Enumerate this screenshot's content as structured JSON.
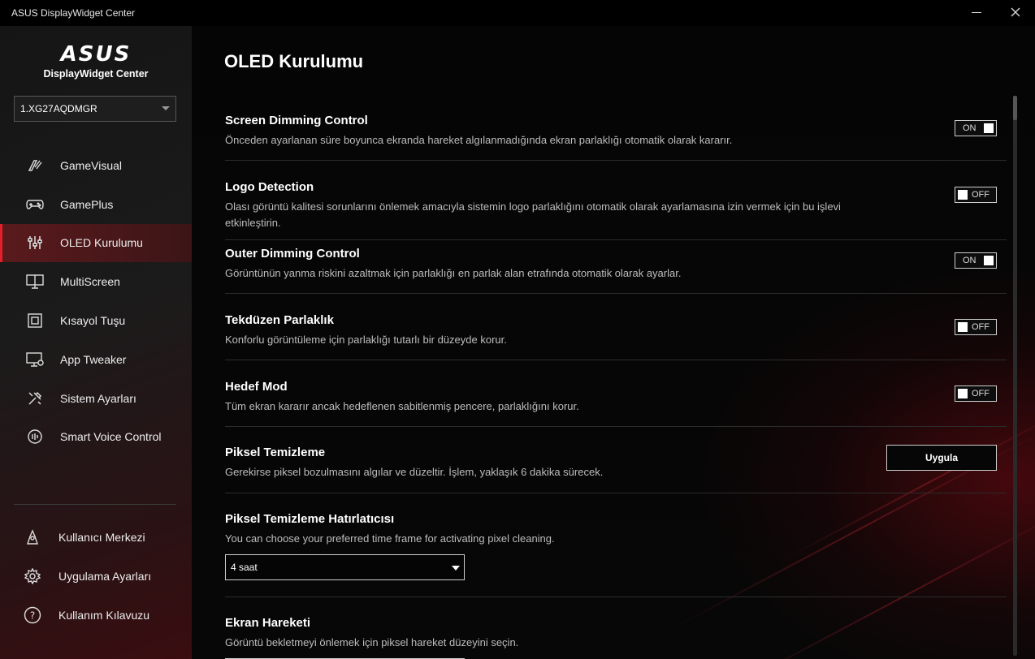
{
  "window": {
    "title": "ASUS DisplayWidget Center"
  },
  "brand": {
    "logo": "ASUS",
    "subtitle": "DisplayWidget Center"
  },
  "monitor": {
    "selected": "1.XG27AQDMGR"
  },
  "nav": [
    {
      "label": "GameVisual",
      "icon": "gamevisual-icon"
    },
    {
      "label": "GamePlus",
      "icon": "gamepad-icon"
    },
    {
      "label": "OLED Kurulumu",
      "icon": "sliders-icon",
      "active": true
    },
    {
      "label": "MultiScreen",
      "icon": "multiscreen-icon"
    },
    {
      "label": "Kısayol Tuşu",
      "icon": "shortcut-key-icon"
    },
    {
      "label": "App Tweaker",
      "icon": "app-tweaker-icon"
    },
    {
      "label": "Sistem Ayarları",
      "icon": "tools-icon"
    },
    {
      "label": "Smart Voice Control",
      "icon": "voice-icon"
    }
  ],
  "bottom_nav": [
    {
      "label": "Kullanıcı Merkezi",
      "icon": "user-center-icon"
    },
    {
      "label": "Uygulama Ayarları",
      "icon": "gear-icon"
    },
    {
      "label": "Kullanım Kılavuzu",
      "icon": "help-icon"
    }
  ],
  "page": {
    "title": "OLED Kurulumu"
  },
  "settings": [
    {
      "label": "Screen Dimming Control",
      "desc": "Önceden ayarlanan süre boyunca ekranda hareket algılanmadığında ekran parlaklığı otomatik olarak kararır.",
      "state": "ON"
    },
    {
      "label": "Logo Detection",
      "desc": "Olası görüntü kalitesi sorunlarını önlemek amacıyla sistemin logo parlaklığını otomatik olarak ayarlamasına izin vermek için bu işlevi etkinleştirin.",
      "state": "OFF"
    },
    {
      "label": "Outer Dimming Control",
      "desc": "Görüntünün yanma riskini azaltmak için parlaklığı en parlak alan etrafında otomatik olarak ayarlar.",
      "state": "ON"
    },
    {
      "label": "Tekdüzen Parlaklık",
      "desc": "Konforlu görüntüleme için parlaklığı tutarlı bir düzeyde korur.",
      "state": "OFF"
    },
    {
      "label": "Hedef Mod",
      "desc": "Tüm ekran kararır ancak hedeflenen sabitlenmiş pencere, parlaklığını korur.",
      "state": "OFF"
    },
    {
      "label": "Piksel Temizleme",
      "desc": "Gerekirse piksel bozulmasını algılar ve düzeltir. İşlem, yaklaşık 6 dakika sürecek.",
      "button": "Uygula"
    },
    {
      "label": "Piksel Temizleme Hatırlatıcısı",
      "desc": "You can choose your preferred time frame for activating pixel cleaning.",
      "select": "4 saat"
    },
    {
      "label": "Ekran Hareketi",
      "desc": "Görüntü bekletmeyi önlemek için piksel hareket düzeyini seçin."
    }
  ]
}
